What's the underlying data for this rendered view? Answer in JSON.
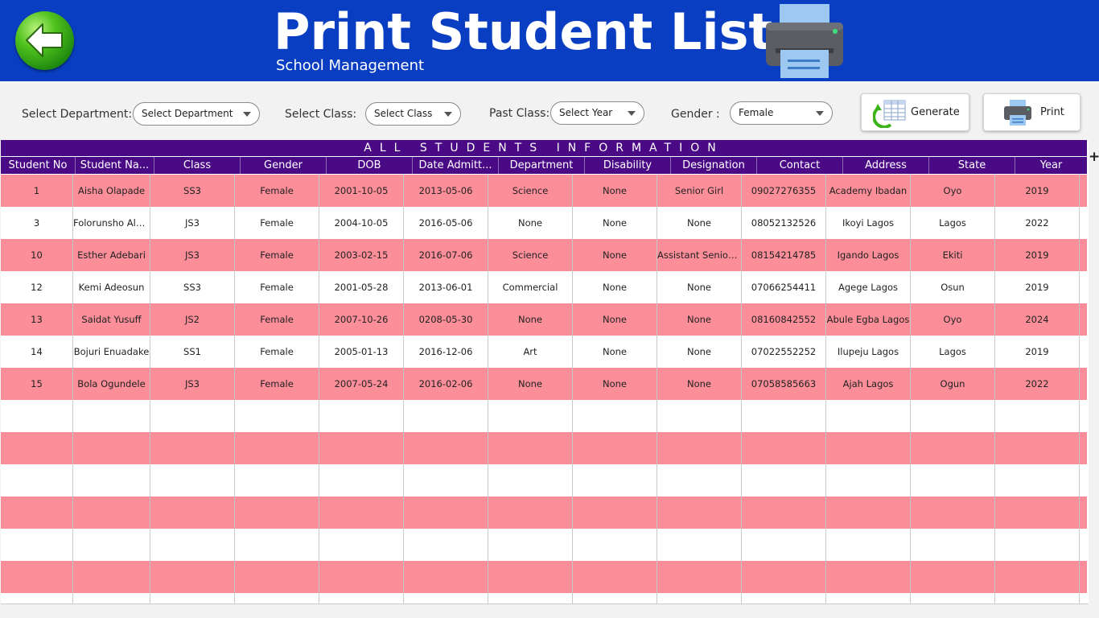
{
  "header": {
    "title": "Print Student List",
    "subtitle": "School Management"
  },
  "filters": {
    "department_label": "Select Department:",
    "department_value": "Select Department",
    "class_label": "Select Class:",
    "class_value": "Select Class",
    "past_class_label": "Past Class:",
    "past_class_value": "Select Year",
    "gender_label": "Gender :",
    "gender_value": "Female"
  },
  "buttons": {
    "generate": "Generate",
    "print": "Print"
  },
  "table": {
    "banner": "ALL STUDENTS INFORMATION",
    "columns": [
      "Student No",
      "Student Na...",
      "Class",
      "Gender",
      "DOB",
      "Date Admitt...",
      "Department",
      "Disability",
      "Designation",
      "Contact",
      "Address",
      "State",
      "Year"
    ],
    "rows": [
      [
        "1",
        "Aisha Olapade",
        "SS3",
        "Female",
        "2001-10-05",
        "2013-05-06",
        "Science",
        "None",
        "Senior Girl",
        "09027276355",
        "Academy Ibadan",
        "Oyo",
        "2019"
      ],
      [
        "3",
        "Folorunsho Ala...",
        "JS3",
        "Female",
        "2004-10-05",
        "2016-05-06",
        "None",
        "None",
        "None",
        "08052132526",
        "Ikoyi Lagos",
        "Lagos",
        "2022"
      ],
      [
        "10",
        "Esther Adebari",
        "JS3",
        "Female",
        "2003-02-15",
        "2016-07-06",
        "Science",
        "None",
        "Assistant Senior ...",
        "08154214785",
        "Igando Lagos",
        "Ekiti",
        "2019"
      ],
      [
        "12",
        "Kemi Adeosun",
        "SS3",
        "Female",
        "2001-05-28",
        "2013-06-01",
        "Commercial",
        "None",
        "None",
        "07066254411",
        "Agege Lagos",
        "Osun",
        "2019"
      ],
      [
        "13",
        "Saidat Yusuff",
        "JS2",
        "Female",
        "2007-10-26",
        "0208-05-30",
        "None",
        "None",
        "None",
        "08160842552",
        "Abule Egba Lagos",
        "Oyo",
        "2024"
      ],
      [
        "14",
        "Bojuri Enuadake",
        "SS1",
        "Female",
        "2005-01-13",
        "2016-12-06",
        "Art",
        "None",
        "None",
        "07022552252",
        "Ilupeju Lagos",
        "Lagos",
        "2019"
      ],
      [
        "15",
        "Bola Ogundele",
        "JS3",
        "Female",
        "2007-05-24",
        "2016-02-06",
        "None",
        "None",
        "None",
        "07058585663",
        "Ajah Lagos",
        "Ogun",
        "2022"
      ]
    ]
  },
  "icons": {
    "back": "arrow-left-icon",
    "printer": "printer-icon",
    "generate": "table-refresh-icon",
    "print": "printer-icon",
    "add_column": "plus-icon"
  },
  "colors": {
    "header_bg": "#0a3ec2",
    "table_header_bg": "#4a0a86",
    "row_alt": "#fb8e98",
    "back_button": "#3cb318"
  }
}
